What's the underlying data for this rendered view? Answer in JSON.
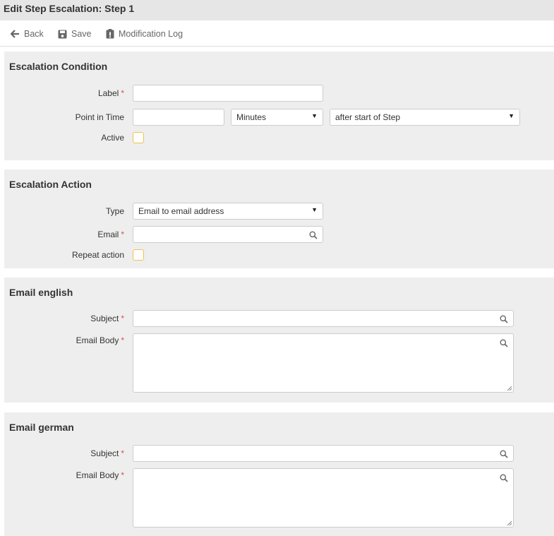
{
  "title": "Edit Step Escalation: Step 1",
  "toolbar": {
    "back_label": "Back",
    "back_icon": "arrow-left-icon",
    "save_label": "Save",
    "save_icon": "floppy-disk-icon",
    "log_label": "Modification Log",
    "log_icon": "clipboard-icon"
  },
  "colors": {
    "title_bg": "#e6e6e6",
    "section_bg": "#eeeeee",
    "required": "#d9534f",
    "checkbox_border": "#f0c14b"
  },
  "condition": {
    "heading": "Escalation Condition",
    "label_label": "Label",
    "label_value": "",
    "point_label": "Point in Time",
    "point_value": "",
    "unit_selected": "Minutes",
    "relation_selected": "after start of Step",
    "active_label": "Active",
    "active_checked": false
  },
  "action": {
    "heading": "Escalation Action",
    "type_label": "Type",
    "type_selected": "Email to email address",
    "email_label": "Email",
    "email_value": "",
    "repeat_label": "Repeat action",
    "repeat_checked": false
  },
  "email_english": {
    "heading": "Email english",
    "subject_label": "Subject",
    "subject_value": "",
    "body_label": "Email Body",
    "body_value": ""
  },
  "email_german": {
    "heading": "Email german",
    "subject_label": "Subject",
    "subject_value": "",
    "body_label": "Email Body",
    "body_value": ""
  },
  "required_marker": "*"
}
